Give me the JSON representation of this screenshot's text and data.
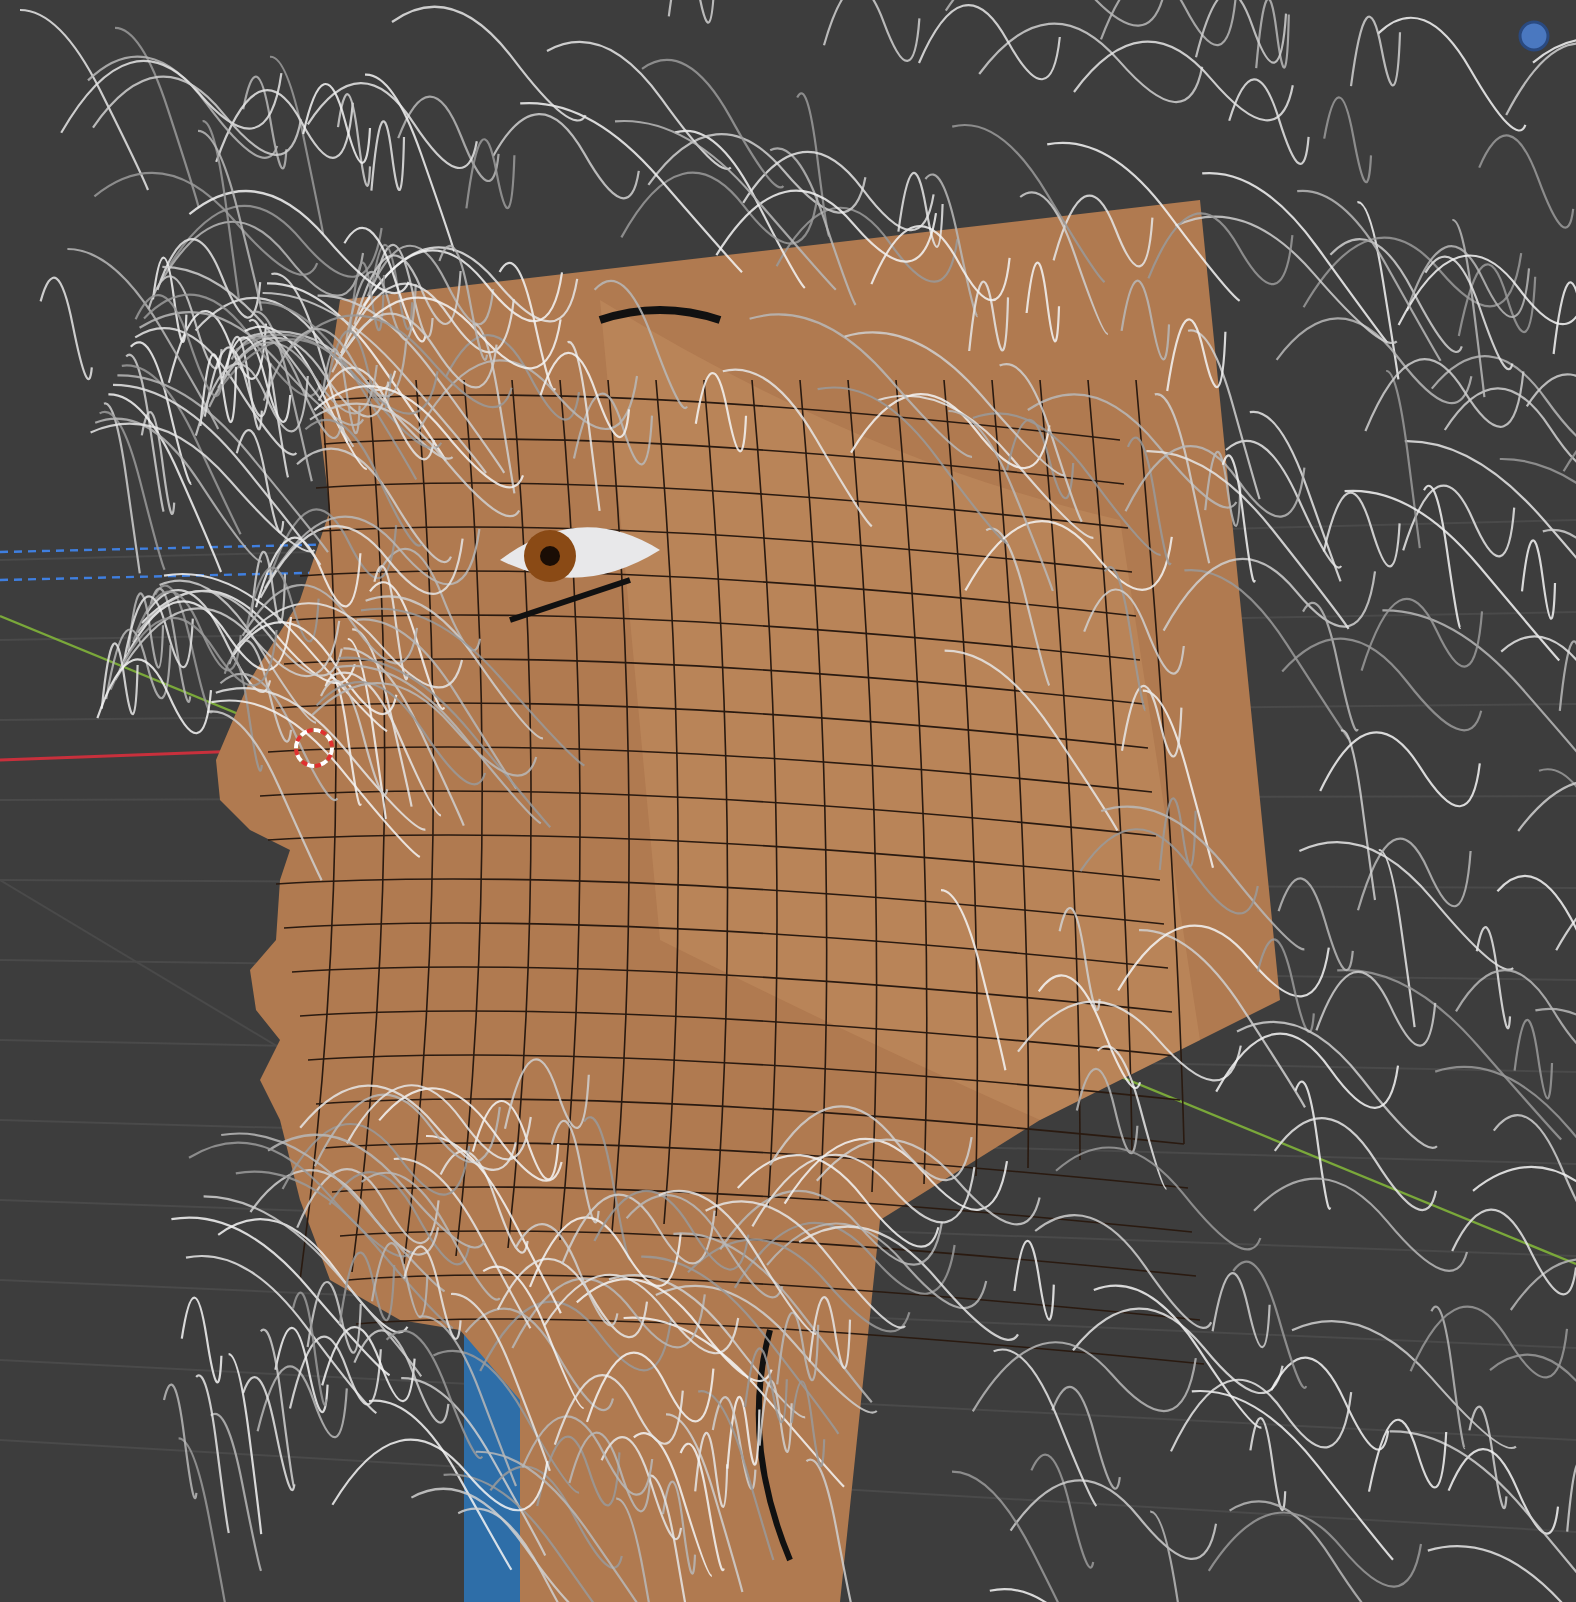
{
  "viewport": {
    "kind": "viewport",
    "wireframe": true,
    "axes": true
  }
}
